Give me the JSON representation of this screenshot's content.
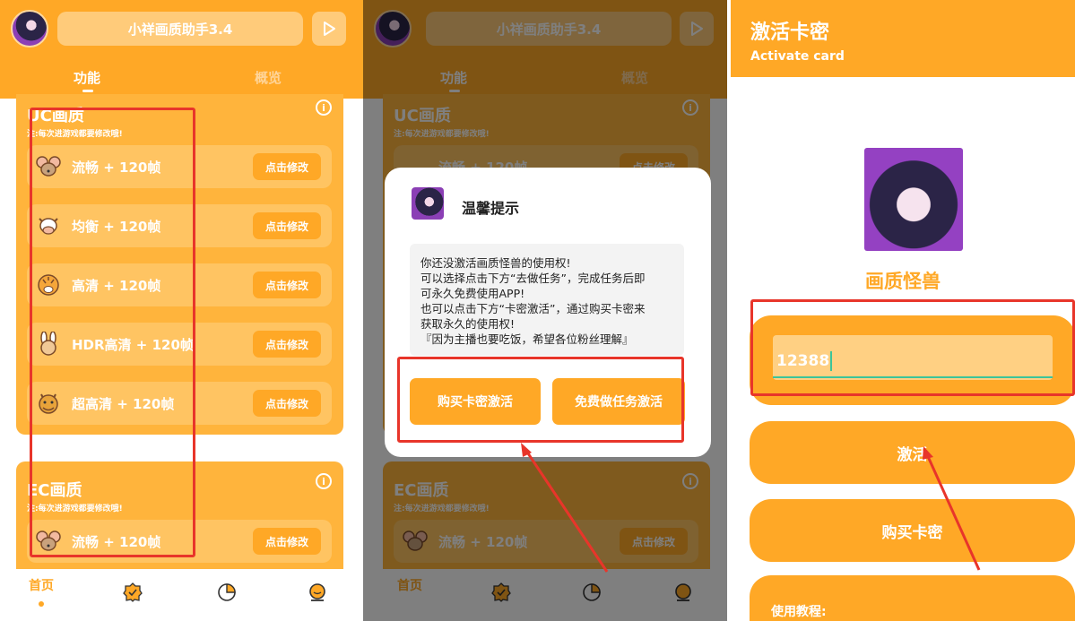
{
  "app": {
    "title": "小祥画质助手3.4",
    "tabs": [
      "功能",
      "概览"
    ]
  },
  "section_uc": {
    "title": "UC画质",
    "note": "注:每次进游戏都要修改哦!",
    "rows": [
      {
        "icon": "mouse-icon",
        "label": "流畅 + 120帧",
        "button": "点击修改"
      },
      {
        "icon": "cow-icon",
        "label": "均衡 + 120帧",
        "button": "点击修改"
      },
      {
        "icon": "tiger-icon",
        "label": "高清 + 120帧",
        "button": "点击修改"
      },
      {
        "icon": "rabbit-icon",
        "label": "HDR高清 + 120帧",
        "button": "点击修改"
      },
      {
        "icon": "dragon-icon",
        "label": "超高清 + 120帧",
        "button": "点击修改"
      }
    ]
  },
  "section_ec": {
    "title": "EC画质",
    "note": "注:每次进游戏都要修改哦!",
    "rows": [
      {
        "icon": "mouse-icon",
        "label": "流畅 + 120帧",
        "button": "点击修改"
      }
    ]
  },
  "bottom_nav": {
    "home_label": "首页"
  },
  "dialog": {
    "title": "温馨提示",
    "body_lines": [
      "你还没激活画质怪兽的使用权!",
      "可以选择点击下方“去做任务”，完成任务后即",
      "可永久免费使用APP!",
      "也可以点击下方“卡密激活”，通过购买卡密来",
      "获取永久的使用权!",
      "『因为主播也要吃饭，希望各位粉丝理解』"
    ],
    "buy_button": "购买卡密激活",
    "task_button": "免费做任务激活"
  },
  "activate": {
    "title": "激活卡密",
    "subtitle": "Activate card",
    "app_name": "画质怪兽",
    "input_value": "12388",
    "activate_button": "激活",
    "buy_button": "购买卡密",
    "tutorial_label": "使用教程:"
  },
  "colors": {
    "accent": "#FFA826",
    "annotation_red": "#E8352A",
    "input_underline": "#3CC49A"
  }
}
